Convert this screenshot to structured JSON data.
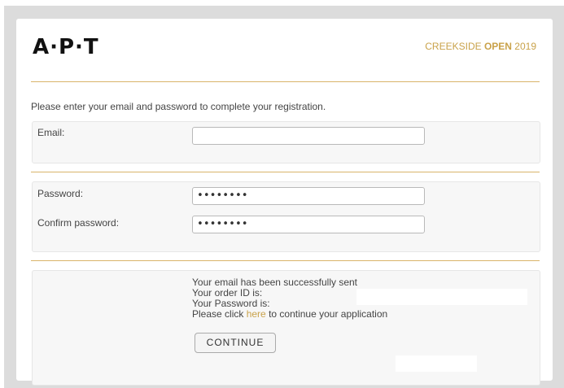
{
  "header": {
    "logo": "A·P·T",
    "event_prefix": "CREEKSIDE ",
    "event_bold": "OPEN",
    "event_suffix": " 2019"
  },
  "intro": "Please enter your email and password to complete your registration.",
  "email": {
    "label": "Email:",
    "value": ""
  },
  "password": {
    "label": "Password:",
    "value": "••••••••"
  },
  "confirm": {
    "label": "Confirm password:",
    "value": "••••••••"
  },
  "result": {
    "line1": "Your email has been successfully sent",
    "line2": "Your order ID is:",
    "line3": "Your Password is:",
    "line4_prefix": "Please click ",
    "line4_link": "here",
    "line4_suffix": " to continue your application",
    "continue_label": "CONTINUE"
  },
  "colors": {
    "accent": "#c9a24a",
    "divider": "#d9b46a",
    "panel_bg": "#f7f7f7"
  }
}
